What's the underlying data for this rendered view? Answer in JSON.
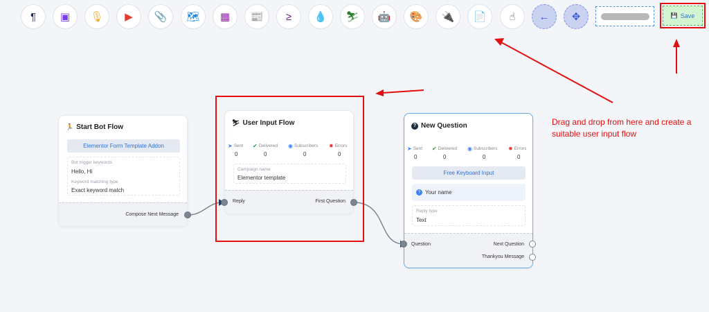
{
  "toolbar": {
    "tools": [
      {
        "name": "paragraph-icon",
        "glyph": "¶",
        "color": "#1f2d5a"
      },
      {
        "name": "image-icon",
        "glyph": "▣",
        "color": "#7a3cf0"
      },
      {
        "name": "microphone-icon",
        "glyph": "🎙",
        "color": "#e8b13a"
      },
      {
        "name": "video-icon",
        "glyph": "▶",
        "color": "#e53935"
      },
      {
        "name": "attachment-icon",
        "glyph": "📎",
        "color": "#43a047"
      },
      {
        "name": "map-icon",
        "glyph": "🗺",
        "color": "#1e88e5"
      },
      {
        "name": "carousel-icon",
        "glyph": "▦",
        "color": "#8e24aa"
      },
      {
        "name": "newspaper-icon",
        "glyph": "📰",
        "color": "#f06292"
      },
      {
        "name": "greater-equal-icon",
        "glyph": "≥",
        "color": "#6a1b9a"
      },
      {
        "name": "drop-icon",
        "glyph": "💧",
        "color": "#d81b60"
      },
      {
        "name": "user-input-icon",
        "glyph": "⛷",
        "color": "#2e7d32"
      },
      {
        "name": "robot-icon",
        "glyph": "🤖",
        "color": "#5e35b1"
      },
      {
        "name": "palette-icon",
        "glyph": "🎨",
        "color": "#00897b"
      },
      {
        "name": "plug-icon",
        "glyph": "🔌",
        "color": "#7b1fa2"
      },
      {
        "name": "spreadsheet-icon",
        "glyph": "📄",
        "color": "#1e88e5"
      },
      {
        "name": "hand-pointer-icon",
        "glyph": "☝",
        "color": "#6d4c41"
      }
    ],
    "nav": [
      {
        "name": "arrow-left-icon",
        "glyph": "←"
      },
      {
        "name": "fit-view-icon",
        "glyph": "✥"
      }
    ],
    "save_label": "Save",
    "save_icon": "💾"
  },
  "nodes": {
    "start": {
      "title": "Start Bot Flow",
      "title_icon": "🏃",
      "addon_button": "Elementor Form Template Addon",
      "keywords_label": "Bot trigger keywords",
      "keywords_value": "Hello, Hi",
      "matching_label": "Keyword matching type",
      "matching_value": "Exact keyword match",
      "output_label": "Compose Next Message"
    },
    "user_input": {
      "title": "User Input Flow",
      "title_icon": "⛷",
      "stats": [
        {
          "label": "Sent",
          "value": "0",
          "icon": "➤",
          "color": "#3b82f6"
        },
        {
          "label": "Delivered",
          "value": "0",
          "icon": "✔",
          "color": "#22a047"
        },
        {
          "label": "Subscribers",
          "value": "0",
          "icon": "◉",
          "color": "#3b82f6"
        },
        {
          "label": "Errors",
          "value": "0",
          "icon": "✸",
          "color": "#e53935"
        }
      ],
      "campaign_label": "Campaign name",
      "campaign_value": "Elementor template",
      "input_port_label": "Reply",
      "output_port_label": "First Question"
    },
    "question": {
      "title": "New Question",
      "title_icon": "?",
      "stats": [
        {
          "label": "Sent",
          "value": "0",
          "icon": "➤",
          "color": "#3b82f6"
        },
        {
          "label": "Delivered",
          "value": "0",
          "icon": "✔",
          "color": "#22a047"
        },
        {
          "label": "Subscribers",
          "value": "0",
          "icon": "◉",
          "color": "#3b82f6"
        },
        {
          "label": "Errors",
          "value": "0",
          "icon": "✸",
          "color": "#e53935"
        }
      ],
      "input_type_button": "Free Keyboard Input",
      "question_text": "Your name",
      "reply_type_label": "Reply type",
      "reply_type_value": "Text",
      "input_port_label": "Question",
      "next_port_label": "Next Question",
      "thankyou_port_label": "Thankyou Message"
    }
  },
  "annotation": {
    "text": "Drag and drop from here and create a suitable user input flow",
    "color": "#e21010"
  }
}
